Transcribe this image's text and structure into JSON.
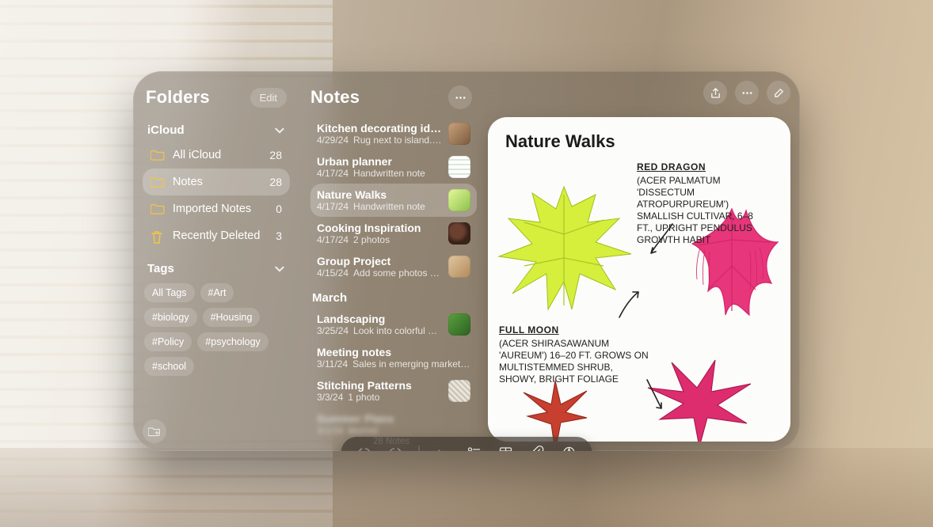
{
  "sidebar": {
    "title": "Folders",
    "edit": "Edit",
    "sections": {
      "icloud": "iCloud",
      "tags": "Tags"
    },
    "folders": [
      {
        "name": "All iCloud",
        "count": "28",
        "icon": "folder"
      },
      {
        "name": "Notes",
        "count": "28",
        "icon": "folder",
        "selected": true
      },
      {
        "name": "Imported Notes",
        "count": "0",
        "icon": "folder"
      },
      {
        "name": "Recently Deleted",
        "count": "3",
        "icon": "trash"
      }
    ],
    "tags": [
      "All Tags",
      "#Art",
      "#biology",
      "#Housing",
      "#Policy",
      "#psychology",
      "#school"
    ]
  },
  "notesList": {
    "title": "Notes",
    "footer": "28 Notes",
    "monthHeader": "March",
    "items": [
      {
        "title": "Kitchen decorating ideas",
        "date": "4/29/24",
        "snippet": "Rug next to island. Conte…",
        "thumb": "kitchen"
      },
      {
        "title": "Urban planner",
        "date": "4/17/24",
        "snippet": "Handwritten note",
        "thumb": "plan"
      },
      {
        "title": "Nature Walks",
        "date": "4/17/24",
        "snippet": "Handwritten note",
        "thumb": "leaf",
        "selected": true
      },
      {
        "title": "Cooking Inspiration",
        "date": "4/17/24",
        "snippet": "2 photos",
        "thumb": "food"
      },
      {
        "title": "Group Project",
        "date": "4/15/24",
        "snippet": "Add some photos of their…",
        "thumb": "group"
      }
    ],
    "marchItems": [
      {
        "title": "Landscaping",
        "date": "3/25/24",
        "snippet": "Look into colorful perenn…",
        "thumb": "land"
      },
      {
        "title": "Meeting notes",
        "date": "3/11/24",
        "snippet": "Sales in emerging markets are tr…"
      },
      {
        "title": "Stitching Patterns",
        "date": "3/3/24",
        "snippet": "1 photo",
        "thumb": "stitch"
      },
      {
        "title": "Summer Plans",
        "date": "3/1/24",
        "snippet": "blurred",
        "blurred": true
      }
    ]
  },
  "detail": {
    "title": "Nature Walks",
    "annotations": {
      "red_dragon_title": "RED DRAGON",
      "red_dragon_body": "(ACER PALMATUM 'DISSECTUM ATROPURPUREUM') SMALLISH CULTIVAR, 6–8 FT., UPRIGHT PENDULUS GROWTH HABIT",
      "full_moon_title": "FULL MOON",
      "full_moon_body": "(ACER SHIRASAWANUM 'AUREUM') 16–20 FT. GROWS ON MULTISTEMMED SHRUB, SHOWY, BRIGHT FOLIAGE"
    }
  },
  "toolbar": {
    "items": [
      "undo",
      "redo",
      "sep",
      "format",
      "checklist",
      "table",
      "attach",
      "markup"
    ]
  }
}
